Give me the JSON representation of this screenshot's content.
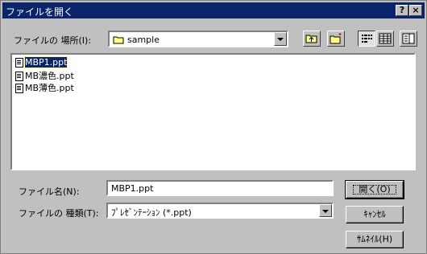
{
  "window": {
    "title": "ファイルを開く",
    "help_glyph": "?",
    "close_glyph": "×"
  },
  "location": {
    "label": "ファイルの 場所(I):",
    "value": "sample",
    "folder_icon": "folder-icon"
  },
  "toolbar": [
    {
      "name": "up-folder-icon"
    },
    {
      "name": "new-folder-icon"
    },
    {
      "name": "list-view-icon",
      "pressed": true
    },
    {
      "name": "details-view-icon"
    },
    {
      "name": "properties-view-icon"
    }
  ],
  "files": [
    {
      "name": "MBP1.ppt",
      "selected": true
    },
    {
      "name": "MB濃色.ppt",
      "selected": false
    },
    {
      "name": "MB薄色.ppt",
      "selected": false
    }
  ],
  "filename": {
    "label": "ファイル名(N):",
    "value": "MBP1.ppt"
  },
  "filetype": {
    "label": "ファイルの 種類(T):",
    "value": "ﾌﾟﾚｾﾞﾝﾃｰｼｮﾝ (*.ppt)"
  },
  "buttons": {
    "open": "開く(O)",
    "cancel": "ｷｬﾝｾﾙ",
    "thumbnail": "ｻﾑﾈｲﾙ(H)"
  }
}
